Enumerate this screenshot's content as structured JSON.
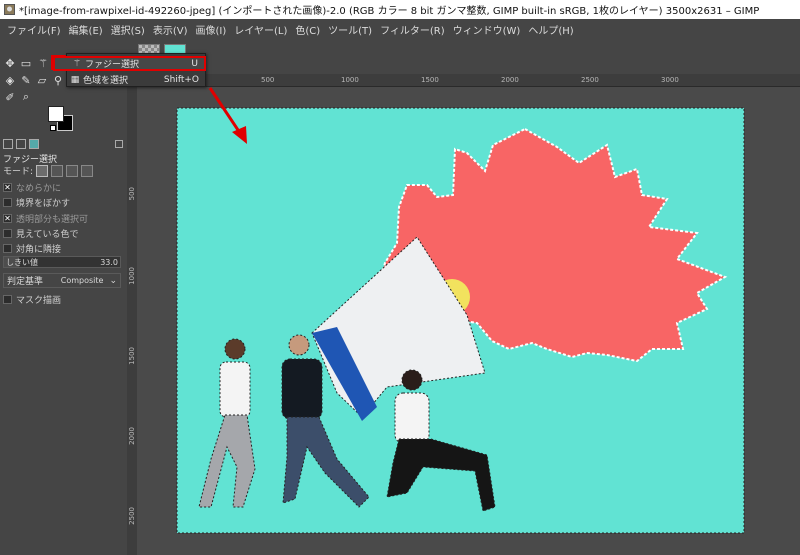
{
  "window": {
    "title": "*[image-from-rawpixel-id-492260-jpeg] (インポートされた画像)-2.0 (RGB カラー 8 bit ガンマ整数, GIMP built-in sRGB, 1枚のレイヤー) 3500x2631 – GIMP"
  },
  "menu": [
    "ファイル(F)",
    "編集(E)",
    "選択(S)",
    "表示(V)",
    "画像(I)",
    "レイヤー(L)",
    "色(C)",
    "ツール(T)",
    "フィルター(R)",
    "ウィンドウ(W)",
    "ヘルプ(H)"
  ],
  "popup": {
    "items": [
      {
        "label": "ファジー選択",
        "shortcut": "U",
        "icon": "fuzzy-select-icon"
      },
      {
        "label": "色域を選択",
        "shortcut": "Shift+O",
        "icon": "select-by-color-icon"
      }
    ]
  },
  "tool_options": {
    "title": "ファジー選択",
    "mode_label": "モード:",
    "options": [
      {
        "label": "なめらかに",
        "checked": true,
        "dim": true
      },
      {
        "label": "境界をぼかす",
        "checked": false,
        "dim": false
      },
      {
        "label": "透明部分も選択可",
        "checked": true,
        "dim": true
      },
      {
        "label": "見えている色で",
        "checked": false,
        "dim": false
      },
      {
        "label": "対角に隣接",
        "checked": false,
        "dim": false
      }
    ],
    "threshold_label": "しきい値",
    "threshold_value": "33.0",
    "criterion_label": "判定基準",
    "criterion_value": "Composite",
    "draw_mask": {
      "label": "マスク描画",
      "checked": false
    }
  },
  "rulers": {
    "top": [
      "500",
      "1000",
      "1500",
      "2000",
      "2500",
      "3000"
    ],
    "left": [
      "500",
      "1000",
      "1500",
      "2000",
      "2500"
    ]
  },
  "colors": {
    "accent_highlight": "#e00000",
    "canvas_teal": "#61e3d3",
    "burst_red": "#f86565"
  }
}
